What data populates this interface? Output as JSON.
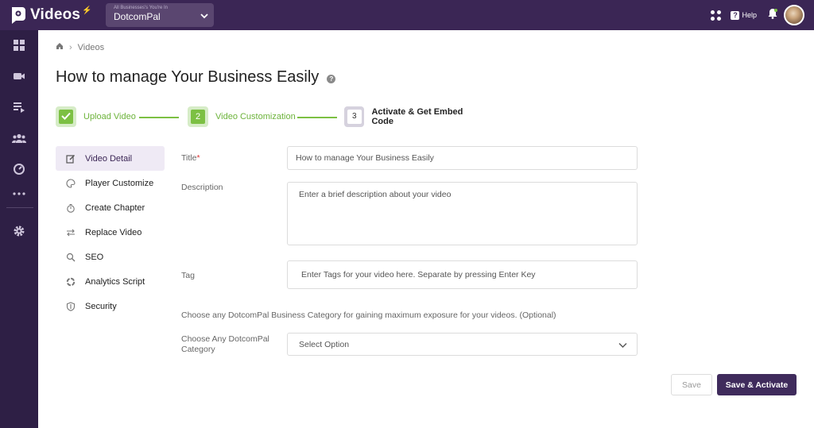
{
  "app": {
    "logo_text": "Videos",
    "logo_spark": "⚡"
  },
  "business": {
    "caption": "All Businesses's You're In",
    "name": "DotcomPal"
  },
  "topbar": {
    "help_label": "Help",
    "help_glyph": "?"
  },
  "sidebar": {
    "icons": [
      "dashboard-icon",
      "video-camera-icon",
      "playlist-icon",
      "people-icon",
      "analytics-gauge-icon",
      "more-dots-icon",
      "settings-gear-icon"
    ]
  },
  "breadcrumb": {
    "current": "Videos",
    "separator": "›"
  },
  "page": {
    "title": "How to manage Your Business Easily",
    "help_glyph": "?"
  },
  "stepper": {
    "steps": [
      {
        "number": "",
        "label": "Upload Video",
        "state": "completed"
      },
      {
        "number": "2",
        "label": "Video Customization",
        "state": "active"
      },
      {
        "number": "3",
        "label": "Activate & Get Embed Code",
        "state": "pending"
      }
    ]
  },
  "leftnav": {
    "items": [
      {
        "label": "Video Detail",
        "icon": "edit-icon",
        "active": true
      },
      {
        "label": "Player Customize",
        "icon": "palette-icon",
        "active": false
      },
      {
        "label": "Create Chapter",
        "icon": "timer-icon",
        "active": false
      },
      {
        "label": "Replace Video",
        "icon": "swap-arrows-icon",
        "active": false
      },
      {
        "label": "SEO",
        "icon": "magnifier-icon",
        "active": false
      },
      {
        "label": "Analytics Script",
        "icon": "analytics-ring-icon",
        "active": false
      },
      {
        "label": "Security",
        "icon": "shield-icon",
        "active": false
      }
    ]
  },
  "form": {
    "title_label": "Title",
    "title_required_mark": "*",
    "title_value": "How to manage Your Business Easily",
    "description_label": "Description",
    "description_placeholder": "Enter a brief description about your video",
    "tag_label": "Tag",
    "tag_placeholder": "Enter Tags for your video here. Separate by pressing Enter Key",
    "category_note": "Choose any DotcomPal Business Category for gaining maximum exposure for your videos. (Optional)",
    "category_label": "Choose Any DotcomPal Category",
    "category_value": "Select Option"
  },
  "actions": {
    "save_label": "Save",
    "save_activate_label": "Save & Activate"
  },
  "colors": {
    "topbar": "#3b2655",
    "sidebar": "#2e1f45",
    "accent_green": "#7cc043",
    "primary_button": "#3f2b5c"
  }
}
